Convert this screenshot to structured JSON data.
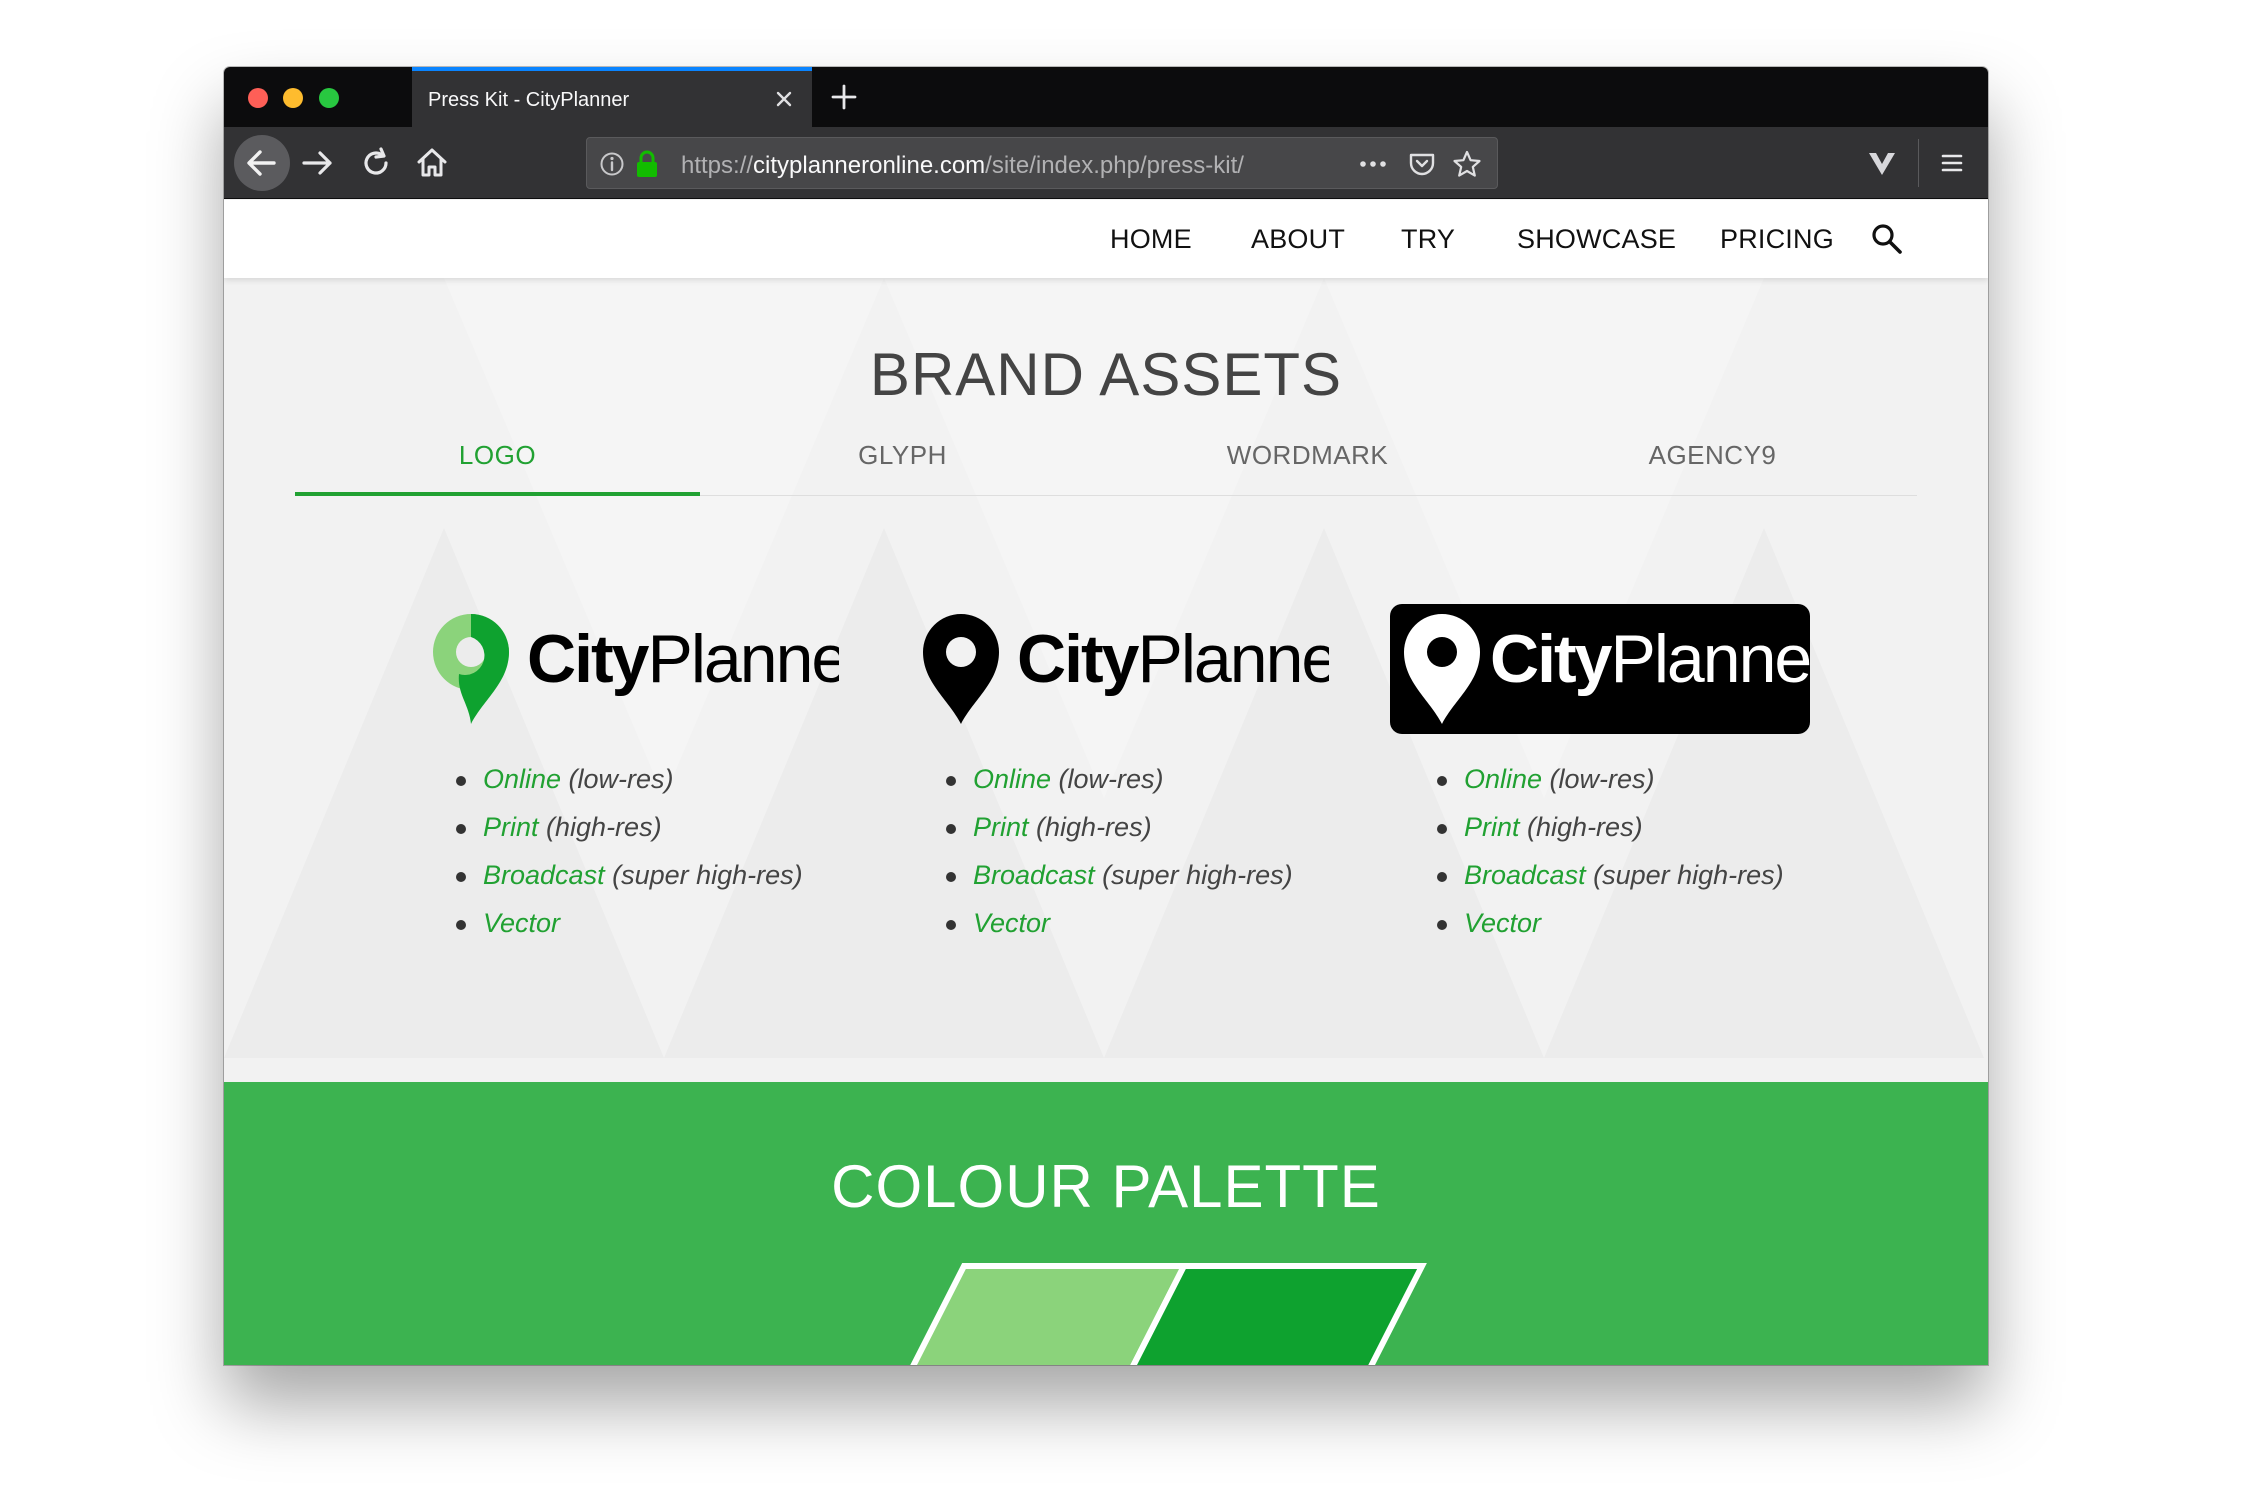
{
  "browser": {
    "tab_title": "Press Kit - CityPlanner",
    "url_scheme": "https://",
    "url_host": "cityplanneronline.com",
    "url_path": "/site/index.php/press-kit/",
    "icons": [
      "back-arrow-icon",
      "forward-arrow-icon",
      "reload-icon",
      "home-icon",
      "info-icon",
      "lock-icon",
      "more-icon",
      "pocket-icon",
      "star-icon",
      "extension-v-icon",
      "hamburger-menu-icon",
      "close-icon",
      "plus-icon"
    ]
  },
  "nav": {
    "items": [
      "HOME",
      "ABOUT",
      "TRY",
      "SHOWCASE",
      "PRICING"
    ],
    "search_icon": "search-icon"
  },
  "brand": {
    "title": "BRAND ASSETS",
    "tabs": [
      "LOGO",
      "GLYPH",
      "WORDMARK",
      "AGENCY9"
    ],
    "active_tab": "LOGO",
    "logo_text_bold": "City",
    "logo_text_light": "Planner",
    "columns": [
      {
        "variant": "color",
        "links": [
          {
            "label": "Online",
            "note": " (low-res)"
          },
          {
            "label": "Print",
            "note": " (high-res)"
          },
          {
            "label": "Broadcast",
            "note": " (super high-res)"
          },
          {
            "label": "Vector",
            "note": ""
          }
        ]
      },
      {
        "variant": "black",
        "links": [
          {
            "label": "Online",
            "note": " (low-res)"
          },
          {
            "label": "Print",
            "note": " (high-res)"
          },
          {
            "label": "Broadcast",
            "note": " (super high-res)"
          },
          {
            "label": "Vector",
            "note": ""
          }
        ]
      },
      {
        "variant": "inverted",
        "links": [
          {
            "label": "Online",
            "note": " (low-res)"
          },
          {
            "label": "Print",
            "note": " (high-res)"
          },
          {
            "label": "Broadcast",
            "note": " (super high-res)"
          },
          {
            "label": "Vector",
            "note": ""
          }
        ]
      }
    ]
  },
  "palette": {
    "title": "COLOUR PALETTE",
    "swatches": [
      "#8bd37b",
      "#0ea22f"
    ]
  },
  "colors": {
    "accent": "#21a132",
    "section_green": "#3cb350",
    "logo_green_light": "#8bd37b",
    "logo_green_dark": "#0ea22f"
  }
}
